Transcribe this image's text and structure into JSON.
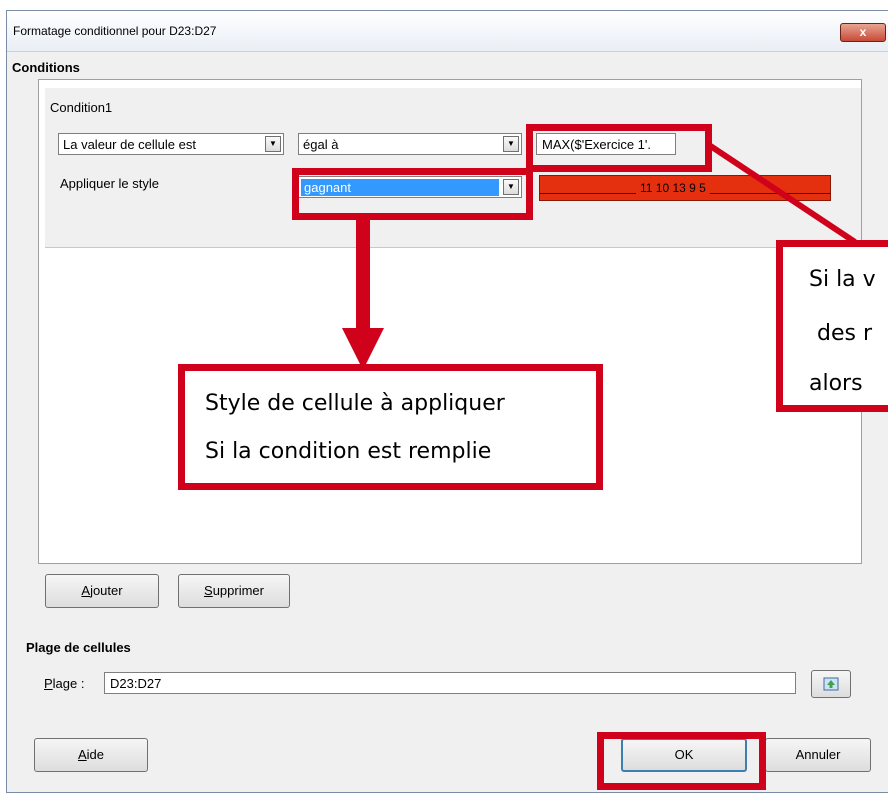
{
  "window": {
    "title": "Formatage conditionnel pour D23:D27",
    "close_glyph": "x"
  },
  "conditions": {
    "section_label": "Conditions",
    "condition_label": "Condition1",
    "type_select": "La valeur de cellule est",
    "operator_select": "égal à",
    "formula_value": "MAX($'Exercice 1'.",
    "apply_style_label": "Appliquer le style",
    "style_select": "gagnant",
    "preview_text": "11 10 13 9 5"
  },
  "buttons": {
    "add": "Ajouter",
    "add_accel": "A",
    "remove": "Supprimer",
    "remove_accel": "S",
    "help": "Aide",
    "help_accel": "A",
    "ok": "OK",
    "cancel": "Annuler"
  },
  "range": {
    "section_label": "Plage de cellules",
    "field_label": "Plage :",
    "field_accel": "P",
    "field_value": "D23:D27"
  },
  "annotations": {
    "style_callout": [
      "Style de cellule à appliquer",
      "Si la condition est remplie"
    ],
    "right_callout": [
      "Si la v",
      "des r",
      "alors"
    ]
  },
  "colors": {
    "annotation_red": "#d0021b",
    "style_preview": "#e5300f",
    "selected_highlight": "#3399ff"
  }
}
